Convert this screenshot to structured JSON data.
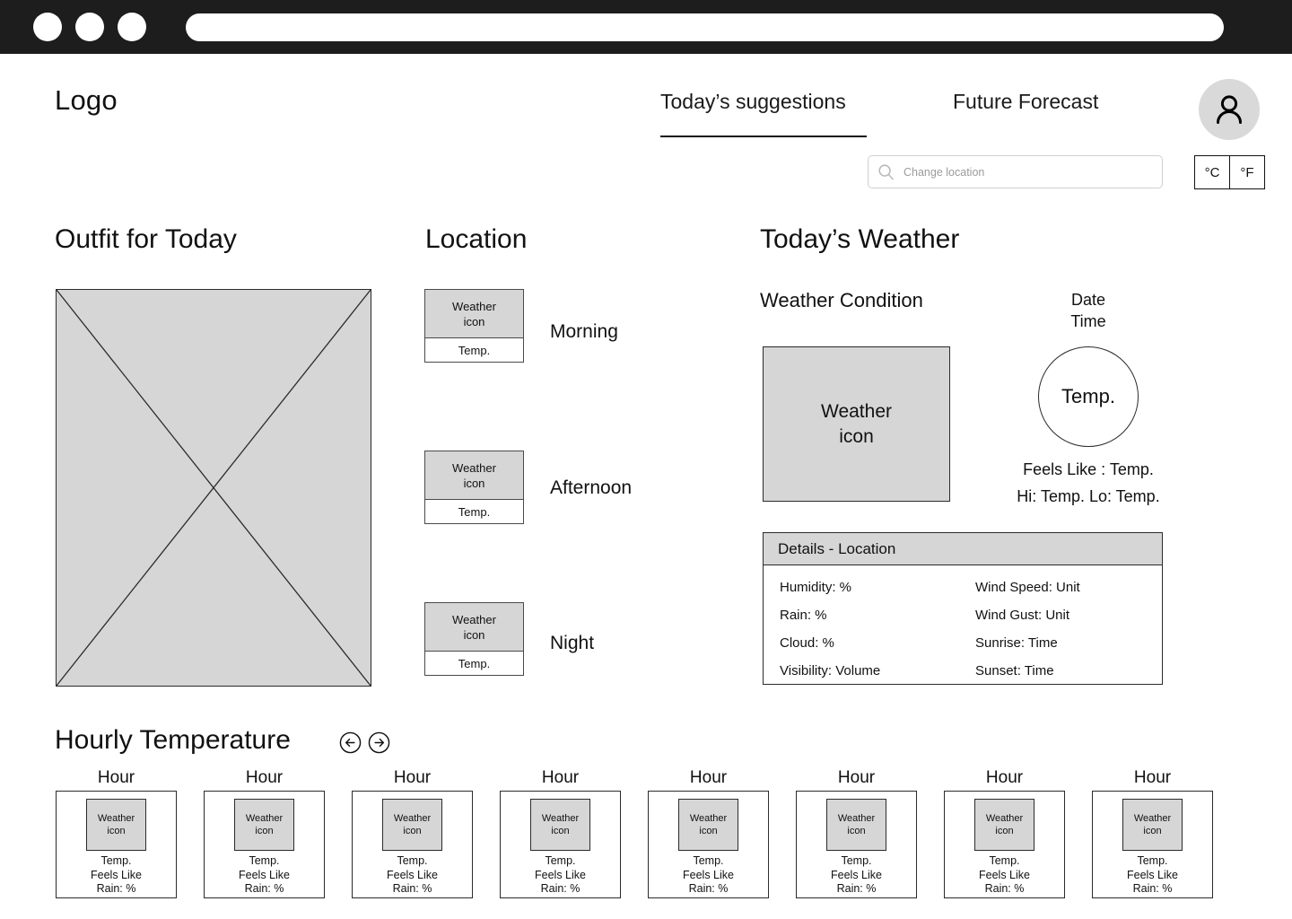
{
  "browser": {
    "dots": [
      "window-dot",
      "window-dot",
      "window-dot"
    ],
    "url_value": ""
  },
  "header": {
    "logo": "Logo",
    "tabs": [
      {
        "label": "Today’s suggestions",
        "active": true
      },
      {
        "label": "Future Forecast",
        "active": false
      }
    ],
    "avatar_icon": "user-avatar-icon",
    "search": {
      "icon": "search-icon",
      "placeholder": "Change location",
      "value": ""
    },
    "units": [
      {
        "label": "°C"
      },
      {
        "label": "°F"
      }
    ]
  },
  "sections": {
    "outfit_title": "Outfit for Today",
    "location_title": "Location",
    "weather_title": "Today’s Weather",
    "hourly_title": "Hourly Temperature"
  },
  "outfit": {
    "placeholder_icon": "image-placeholder-crossed-box"
  },
  "location": {
    "cards": [
      {
        "icon_label": "Weather\nicon",
        "icon_line1": "Weather",
        "icon_line2": "icon",
        "temp": "Temp.",
        "period": "Morning"
      },
      {
        "icon_line1": "Weather",
        "icon_line2": "icon",
        "temp": "Temp.",
        "period": "Afternoon"
      },
      {
        "icon_line1": "Weather",
        "icon_line2": "icon",
        "temp": "Temp.",
        "period": "Night"
      }
    ]
  },
  "today_weather": {
    "condition_label": "Weather Condition",
    "icon_line1": "Weather",
    "icon_line2": "icon",
    "date": "Date",
    "time": "Time",
    "temp_circle": "Temp.",
    "feels_like": "Feels Like : Temp.",
    "hi_lo": "Hi: Temp.   Lo: Temp.",
    "details": {
      "header": "Details - Location",
      "rows": [
        {
          "left": "Humidity: %",
          "right": "Wind Speed: Unit"
        },
        {
          "left": "Rain: %",
          "right": "Wind Gust: Unit"
        },
        {
          "left": "Cloud: %",
          "right": "Sunrise: Time"
        },
        {
          "left": "Visibility: Volume",
          "right": "Sunset: Time"
        }
      ]
    }
  },
  "hourly": {
    "prev_icon": "arrow-left-circle-icon",
    "next_icon": "arrow-right-circle-icon",
    "cards": [
      {
        "hour": "Hour",
        "icon_line1": "Weather",
        "icon_line2": "icon",
        "temp": "Temp.",
        "feels": "Feels Like",
        "rain": "Rain: %"
      },
      {
        "hour": "Hour",
        "icon_line1": "Weather",
        "icon_line2": "icon",
        "temp": "Temp.",
        "feels": "Feels Like",
        "rain": "Rain: %"
      },
      {
        "hour": "Hour",
        "icon_line1": "Weather",
        "icon_line2": "icon",
        "temp": "Temp.",
        "feels": "Feels Like",
        "rain": "Rain: %"
      },
      {
        "hour": "Hour",
        "icon_line1": "Weather",
        "icon_line2": "icon",
        "temp": "Temp.",
        "feels": "Feels Like",
        "rain": "Rain: %"
      },
      {
        "hour": "Hour",
        "icon_line1": "Weather",
        "icon_line2": "icon",
        "temp": "Temp.",
        "feels": "Feels Like",
        "rain": "Rain: %"
      },
      {
        "hour": "Hour",
        "icon_line1": "Weather",
        "icon_line2": "icon",
        "temp": "Temp.",
        "feels": "Feels Like",
        "rain": "Rain: %"
      },
      {
        "hour": "Hour",
        "icon_line1": "Weather",
        "icon_line2": "icon",
        "temp": "Temp.",
        "feels": "Feels Like",
        "rain": "Rain: %"
      },
      {
        "hour": "Hour",
        "icon_line1": "Weather",
        "icon_line2": "icon",
        "temp": "Temp.",
        "feels": "Feels Like",
        "rain": "Rain: %"
      }
    ]
  },
  "colors": {
    "chrome": "#1d1d1d",
    "placeholder_fill": "#d6d6d6",
    "stroke": "#2b2b2b",
    "page_bg": "#ffffff"
  }
}
